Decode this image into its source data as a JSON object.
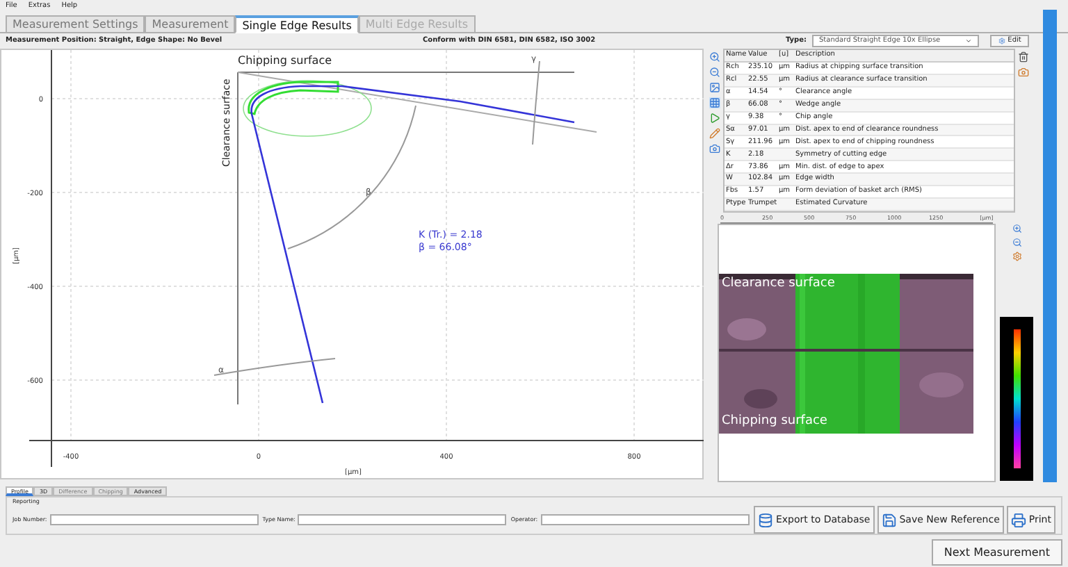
{
  "menu": [
    "File",
    "Extras",
    "Help"
  ],
  "tabs": [
    {
      "label": "Measurement Settings",
      "selected": false,
      "disabled": false
    },
    {
      "label": "Measurement",
      "selected": false,
      "disabled": false
    },
    {
      "label": "Single Edge Results",
      "selected": true,
      "disabled": false
    },
    {
      "label": "Multi Edge Results",
      "selected": false,
      "disabled": true
    }
  ],
  "info": {
    "position": "Measurement Position:  Straight, Edge Shape: No Bevel",
    "conform": "Conform with DIN 6581, DIN 6582, ISO 3002",
    "type_label": "Type:",
    "type_value": "Standard Straight Edge 10x Ellipse",
    "edit": "Edit"
  },
  "profile_plot": {
    "title_top": "Chipping surface",
    "title_side": "Clearance surface",
    "yticks": [
      "0",
      "-200",
      "-400",
      "-600"
    ],
    "xticks": [
      "-400",
      "0",
      "400",
      "800"
    ],
    "xlabel": "[µm]",
    "ylabel": "[µm]",
    "beta_mark": "β",
    "alpha_mark": "α",
    "gamma_mark": "γ",
    "annotation": [
      "K (Tr.) = 2.18",
      "β = 66.08°"
    ]
  },
  "results": {
    "columns": [
      "Name",
      "Value",
      "[u]",
      "Description"
    ],
    "rows": [
      [
        "Rch",
        "235.10",
        "µm",
        "Radius at chipping surface transition"
      ],
      [
        "Rcl",
        "22.55",
        "µm",
        "Radius at clearance surface transition"
      ],
      [
        "α",
        "14.54",
        "°",
        "Clearance angle"
      ],
      [
        "β",
        "66.08",
        "°",
        "Wedge angle"
      ],
      [
        "γ",
        "9.38",
        "°",
        "Chip angle"
      ],
      [
        "Sα",
        "97.01",
        "µm",
        "Dist. apex to end of clearance roundness"
      ],
      [
        "Sγ",
        "211.96",
        "µm",
        "Dist. apex to end of chipping roundness"
      ],
      [
        "K",
        "2.18",
        "",
        "Symmetry of cutting edge"
      ],
      [
        "Δr",
        "73.86",
        "µm",
        "Min. dist. of edge to apex"
      ],
      [
        "W",
        "102.84",
        "µm",
        "Edge width"
      ],
      [
        "Fbs",
        "1.57",
        "µm",
        "Form deviation of basket arch (RMS)"
      ],
      [
        "Ptype",
        "Trumpet",
        "",
        "Estimated Curvature"
      ]
    ]
  },
  "image_view": {
    "ruler": [
      "0",
      "250",
      "500",
      "750",
      "1000",
      "1250",
      "[µm]"
    ],
    "overlays": [
      "Clearance surface",
      "Chipping surface"
    ]
  },
  "bottom_tabs": [
    {
      "label": "Profile",
      "selected": true,
      "disabled": false
    },
    {
      "label": "3D",
      "selected": false,
      "disabled": false
    },
    {
      "label": "Difference",
      "selected": false,
      "disabled": true
    },
    {
      "label": "Chipping",
      "selected": false,
      "disabled": true
    },
    {
      "label": "Advanced",
      "selected": false,
      "disabled": false
    }
  ],
  "reporting": {
    "title": "Reporting",
    "fields": [
      {
        "label": "Job Number:"
      },
      {
        "label": "Type Name:"
      },
      {
        "label": "Operator:"
      }
    ],
    "buttons": [
      {
        "label": "Export to Database",
        "kind": "database"
      },
      {
        "label": "Save New Reference",
        "kind": "save"
      },
      {
        "label": "Print",
        "kind": "print"
      }
    ]
  },
  "next": "Next Measurement"
}
